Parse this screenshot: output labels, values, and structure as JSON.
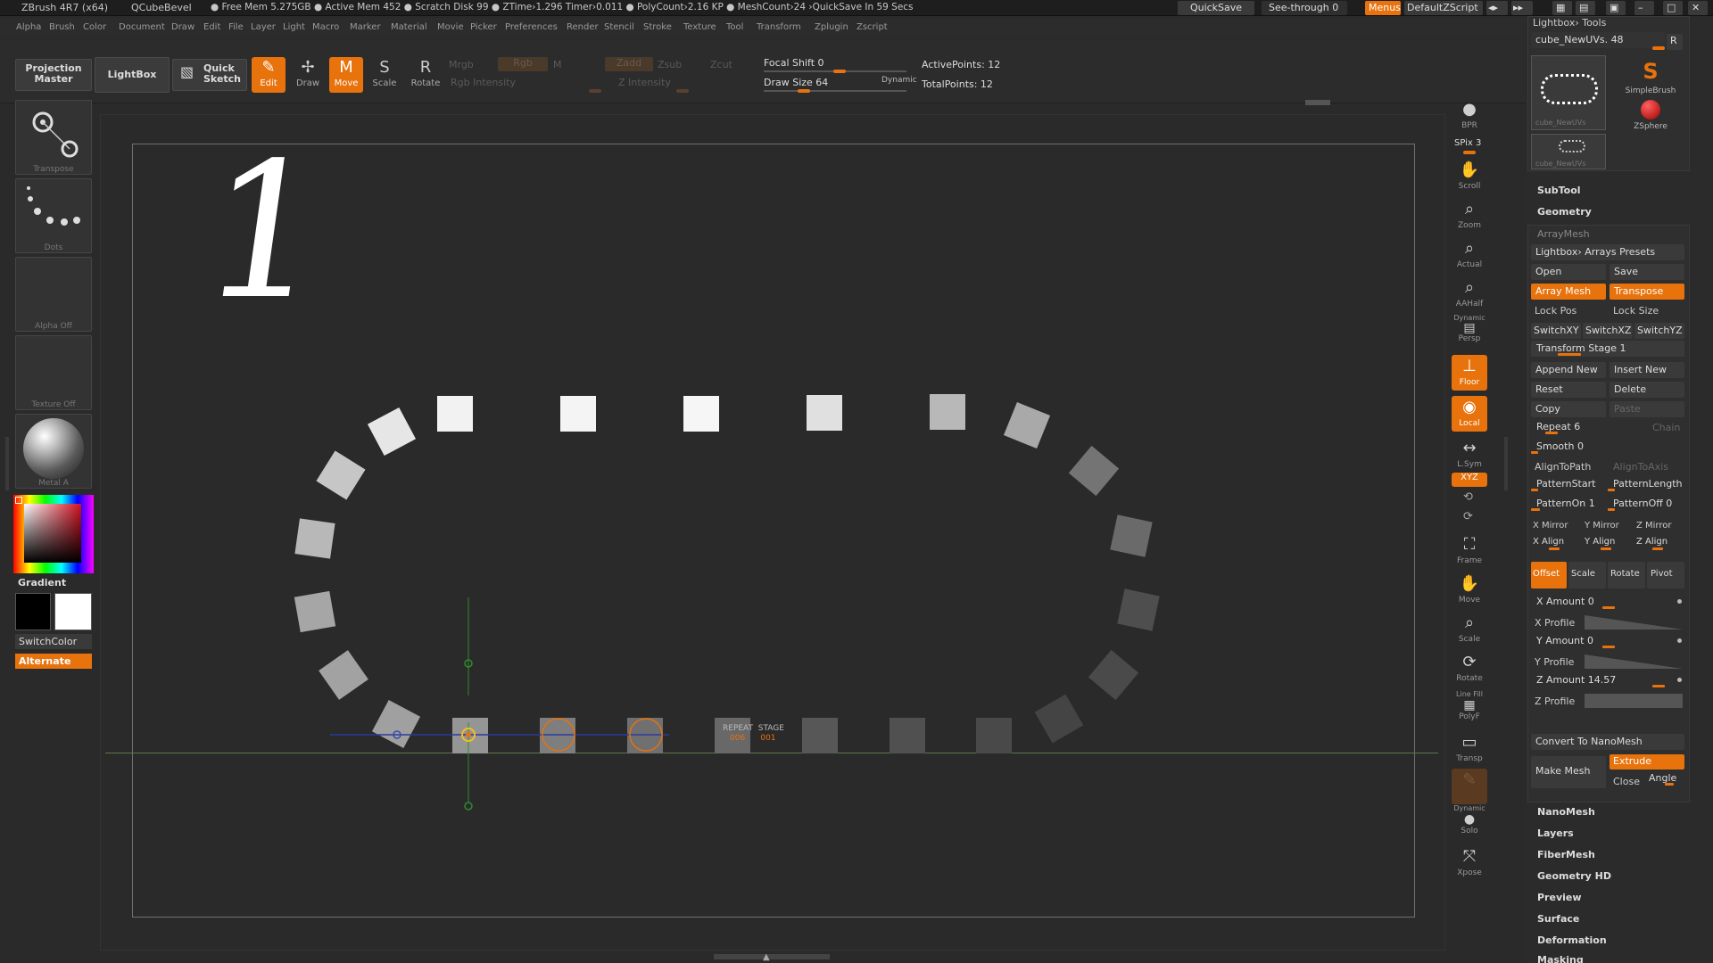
{
  "titlebar": {
    "app": "ZBrush 4R7 (x64)",
    "tool": "QCubeBevel",
    "stats": "● Free Mem 5.275GB ● Active Mem 452 ● Scratch Disk 99 ● ZTime›1.296 Timer›0.011 ● PolyCount›2.16 KP ● MeshCount›24 ›QuickSave In 59 Secs",
    "quicksave": "QuickSave",
    "see_through": "See-through  0",
    "menus": "Menus",
    "default_zscript": "DefaultZScript"
  },
  "menubar": [
    "Alpha",
    "Brush",
    "Color",
    "Document",
    "Draw",
    "Edit",
    "File",
    "Layer",
    "Light",
    "Macro",
    "Marker",
    "Material",
    "Movie",
    "Picker",
    "Preferences",
    "Render",
    "Stencil",
    "Stroke",
    "Texture",
    "Tool",
    "Transform",
    "Zplugin",
    "Zscript"
  ],
  "toolbar": {
    "projection_master": "Projection Master",
    "lightbox": "LightBox",
    "quick_sketch": "Quick Sketch",
    "edit": "Edit",
    "draw": "Draw",
    "move": "Move",
    "scale": "Scale",
    "rotate": "Rotate",
    "mrgb": "Mrgb",
    "rgb": "Rgb",
    "m": "M",
    "rgb_intensity": "Rgb Intensity",
    "zadd": "Zadd",
    "zsub": "Zsub",
    "zcut": "Zcut",
    "z_intensity": "Z Intensity",
    "focal_shift": "Focal Shift 0",
    "draw_size": "Draw Size 64",
    "dynamic": "Dynamic",
    "active_points": "ActivePoints: 12",
    "total_points": "TotalPoints: 12"
  },
  "left_panel": {
    "transpose": "Transpose",
    "dots": "Dots",
    "alpha_off": "Alpha Off",
    "texture_off": "Texture Off",
    "material": "Metal A",
    "gradient": "Gradient",
    "switch_color": "SwitchColor",
    "alternate": "Alternate"
  },
  "canvas": {
    "big_number": "1",
    "repeat_label": "REPEAT",
    "repeat_value": "006",
    "stage_label": "STAGE",
    "stage_value": "001"
  },
  "shelf": {
    "bpr": "BPR",
    "spix": "SPix 3",
    "scroll": "Scroll",
    "zoom": "Zoom",
    "actual": "Actual",
    "aahalf": "AAHalf",
    "dynamic_persp": "Dynamic",
    "persp": "Persp",
    "floor": "Floor",
    "local": "Local",
    "lsym": "L.Sym",
    "xyz": "XYZ",
    "frame": "Frame",
    "move": "Move",
    "scale": "Scale",
    "rotate": "Rotate",
    "line_fill": "Line Fill",
    "polyf": "PolyF",
    "transp": "Transp",
    "dynamic_solo": "Dynamic",
    "solo": "Solo",
    "xpose": "Xpose"
  },
  "tray": {
    "lightbox_tools": "Lightbox› Tools",
    "tool_name": "cube_NewUVs. 48",
    "r": "R",
    "simple_brush": "SimpleBrush",
    "zsphere": "ZSphere",
    "thumb1_caption": "cube_NewUVs",
    "thumb2_caption": "cube_NewUVs",
    "subtool": "SubTool",
    "geometry": "Geometry",
    "arraymesh": "ArrayMesh",
    "lightbox_arrays_presets": "Lightbox› Arrays Presets",
    "open": "Open",
    "save": "Save",
    "array_mesh": "Array Mesh",
    "transpose": "Transpose",
    "lock_pos": "Lock Pos",
    "lock_size": "Lock Size",
    "switch_xy": "SwitchXY",
    "switch_xz": "SwitchXZ",
    "switch_yz": "SwitchYZ",
    "transform_stage": "Transform Stage 1",
    "append_new": "Append New",
    "insert_new": "Insert New",
    "reset": "Reset",
    "delete": "Delete",
    "copy": "Copy",
    "paste": "Paste",
    "repeat": "Repeat 6",
    "chain": "Chain",
    "smooth": "Smooth 0",
    "align_to_path": "AlignToPath",
    "align_to_axis": "AlignToAxis",
    "pattern_start": "PatternStart",
    "pattern_length": "PatternLength",
    "pattern_on": "PatternOn 1",
    "pattern_off": "PatternOff 0",
    "x_mirror": "X Mirror",
    "y_mirror": "Y Mirror",
    "z_mirror": "Z Mirror",
    "x_align": "X Align",
    "y_align": "Y Align",
    "z_align": "Z Align",
    "offset": "Offset",
    "scale": "Scale",
    "rotate": "Rotate",
    "pivot": "Pivot",
    "x_amount": "X Amount 0",
    "x_profile": "X Profile",
    "y_amount": "Y Amount 0",
    "y_profile": "Y Profile",
    "z_amount": "Z Amount 14.57",
    "z_profile": "Z Profile",
    "convert_to_nanomesh": "Convert To NanoMesh",
    "make_mesh": "Make Mesh",
    "extrude": "Extrude",
    "close": "Close",
    "angle": "Angle",
    "nanomesh": "NanoMesh",
    "layers": "Layers",
    "fibermesh": "FiberMesh",
    "geometry_hd": "Geometry HD",
    "preview": "Preview",
    "surface": "Surface",
    "deformation": "Deformation",
    "masking": "Masking"
  },
  "colors": {
    "accent": "#e8720c",
    "background": "#2a2a2a",
    "panel": "#2b2b2b",
    "button": "#3a3a3a"
  }
}
